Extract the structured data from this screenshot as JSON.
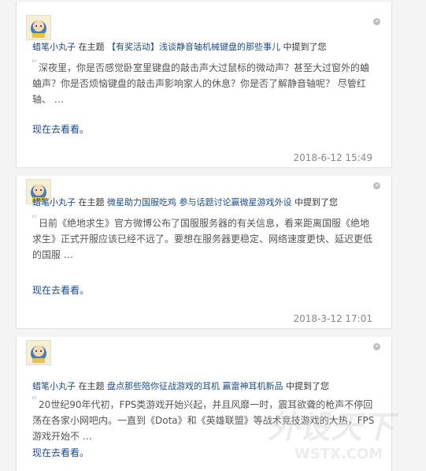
{
  "items": [
    {
      "user": "蜡笔小丸子",
      "in_topic": "在主题",
      "topic": "【有奖活动】浅谈静音轴机械键盘的那些事儿",
      "mentioned": "中提到了您",
      "excerpt": "深夜里，你是否感觉卧室里键盘的敲击声大过鼠标的微动声？甚至大过窗外的蛐蛐声？你是否烦恼键盘的敲击声影响家人的休息？你是否了解静音轴呢？ 尽管红轴、 …",
      "link": "现在去看看。",
      "date": "2018-6-12 15:49"
    },
    {
      "user": "蜡笔小丸子",
      "in_topic": "在主题",
      "topic": "微星助力国服吃鸡 参与话题讨论赢微星游戏外设",
      "mentioned": "中提到了您",
      "excerpt": "日前《绝地求生》官方微博公布了国服服务器的有关信息，看来距离国服《绝地求生》正式开服应该已经不远了。要想在服务器更稳定、网络速度更快、延迟更低的国服 …",
      "link": "现在去看看。",
      "date": "2018-3-12 17:01"
    },
    {
      "user": "蜡笔小丸子",
      "in_topic": "在主题",
      "topic": "盘点那些陪你征战游戏的耳机 赢雷神耳机新品",
      "mentioned": "中提到了您",
      "excerpt": "20世纪90年代初，FPS类游戏开始兴起，并且风靡一时，震耳欲聋的枪声不停回荡在各家小网吧内。一直到《Dota》和《英雄联盟》等战术竞技游戏的大热，FPS游戏开始不 …",
      "link": "现在去看看。",
      "date": ""
    }
  ],
  "watermark": "WSTX.COM"
}
